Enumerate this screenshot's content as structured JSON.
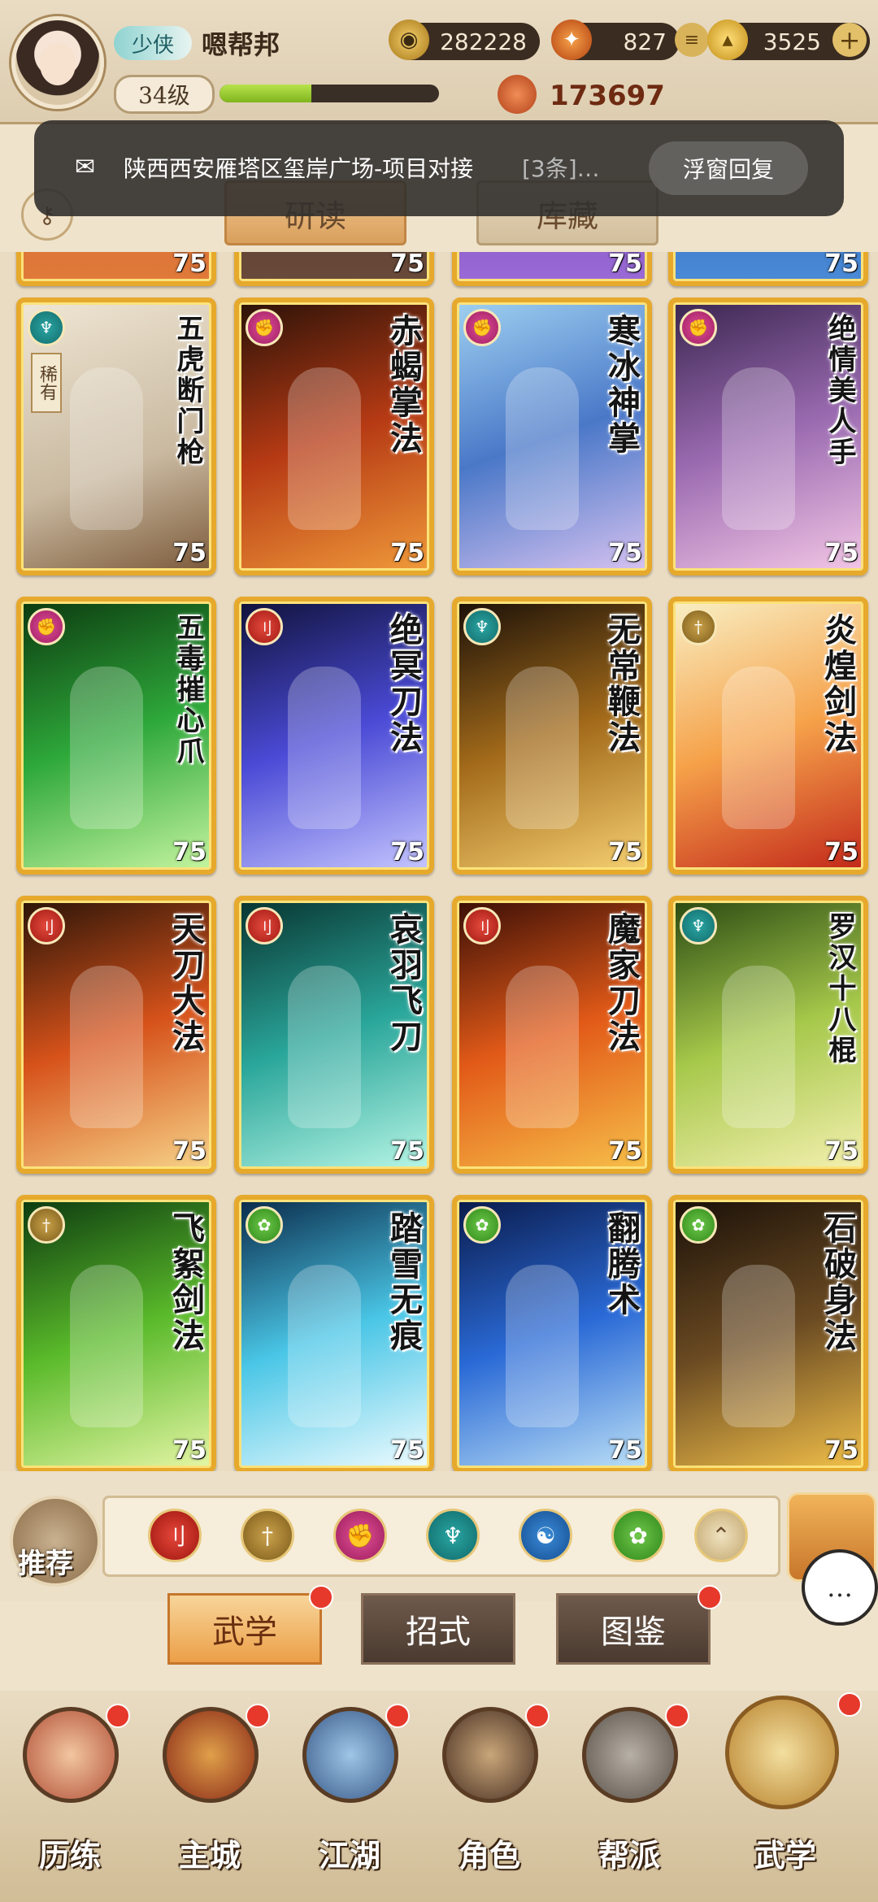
{
  "header": {
    "title_badge": "少侠",
    "player_name": "嗯帮邦",
    "level": "34级",
    "exp_progress": 0.42,
    "coins": "282228",
    "gems": "827",
    "gold": "3525",
    "power": "173697"
  },
  "notification": {
    "message": "陕西西安雁塔区玺岸广场-项目对接",
    "count": "[3条]…",
    "reply_label": "浮窗回复"
  },
  "subtabs": [
    "研读",
    "库藏"
  ],
  "cards": [
    {
      "name": "五虎断门枪",
      "level": "75",
      "element": "fan",
      "rare": "稀有"
    },
    {
      "name": "赤蝎掌法",
      "level": "75",
      "element": "fist"
    },
    {
      "name": "寒冰神掌",
      "level": "75",
      "element": "fist"
    },
    {
      "name": "绝情美人手",
      "level": "75",
      "element": "fist"
    },
    {
      "name": "五毒摧心爪",
      "level": "75",
      "element": "fist"
    },
    {
      "name": "绝冥刀法",
      "level": "75",
      "element": "blade"
    },
    {
      "name": "无常鞭法",
      "level": "75",
      "element": "fan"
    },
    {
      "name": "炎煌剑法",
      "level": "75",
      "element": "sword"
    },
    {
      "name": "天刀大法",
      "level": "75",
      "element": "blade"
    },
    {
      "name": "哀羽飞刀",
      "level": "75",
      "element": "blade"
    },
    {
      "name": "魔家刀法",
      "level": "75",
      "element": "blade"
    },
    {
      "name": "罗汉十八棍",
      "level": "75",
      "element": "fan"
    },
    {
      "name": "飞絮剑法",
      "level": "75",
      "element": "sword"
    },
    {
      "name": "踏雪无痕",
      "level": "75",
      "element": "leg"
    },
    {
      "name": "翻腾术",
      "level": "75",
      "element": "leg"
    },
    {
      "name": "石破身法",
      "level": "75",
      "element": "leg"
    }
  ],
  "top_row_levels": [
    "75",
    "75",
    "75",
    "75"
  ],
  "recommend_label": "推荐",
  "section_tabs": [
    "武学",
    "招式",
    "图鉴"
  ],
  "bottom_nav": [
    "历练",
    "主城",
    "江湖",
    "角色",
    "帮派",
    "武学"
  ]
}
